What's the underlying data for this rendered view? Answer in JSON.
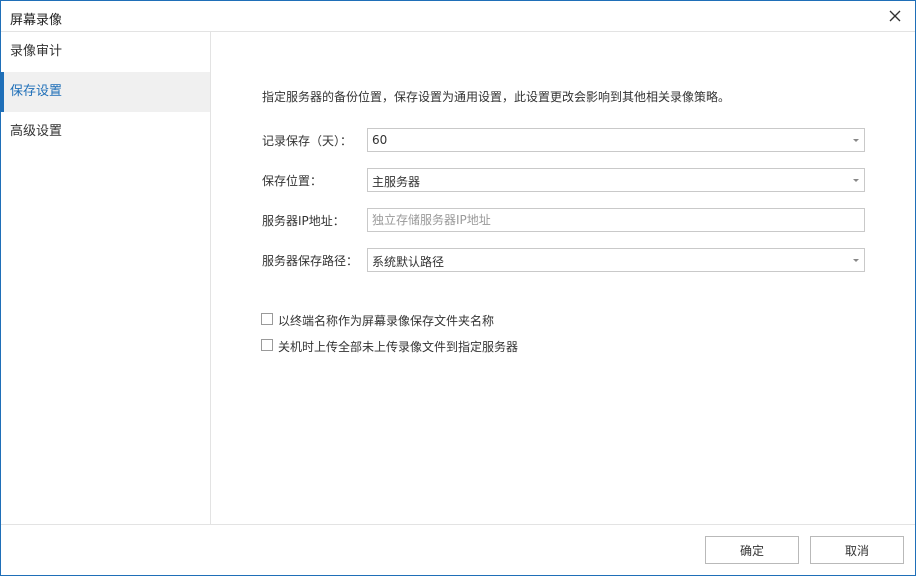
{
  "window": {
    "title": "屏幕录像",
    "close_icon": "close-icon"
  },
  "sidebar": {
    "items": [
      {
        "label": "录像审计",
        "active": false
      },
      {
        "label": "保存设置",
        "active": true
      },
      {
        "label": "高级设置",
        "active": false
      }
    ]
  },
  "main": {
    "description": "指定服务器的备份位置，保存设置为通用设置，此设置更改会影响到其他相关录像策略。",
    "fields": {
      "retention": {
        "label": "记录保存（天）：",
        "value": "60"
      },
      "location": {
        "label": "保存位置：",
        "value": "主服务器"
      },
      "server_ip": {
        "label": "服务器IP地址：",
        "value": "",
        "placeholder": "独立存储服务器IP地址"
      },
      "server_path": {
        "label": "服务器保存路径：",
        "value": "系统默认路径"
      }
    },
    "checkboxes": [
      {
        "label": "以终端名称作为屏幕录像保存文件夹名称",
        "checked": false
      },
      {
        "label": "关机时上传全部未上传录像文件到指定服务器",
        "checked": false
      }
    ]
  },
  "footer": {
    "ok_label": "确定",
    "cancel_label": "取消"
  },
  "colors": {
    "accent": "#1f6fb8",
    "active_bg": "#f0f0f0",
    "border": "#c9c9c9"
  }
}
